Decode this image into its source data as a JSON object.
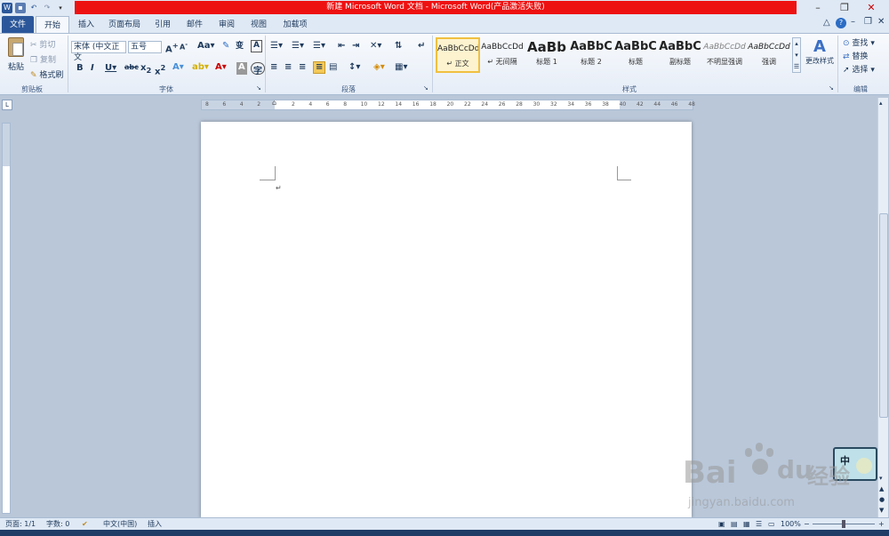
{
  "window": {
    "title": "新建 Microsoft Word 文档 - Microsoft Word(产品激活失败)"
  },
  "tabs": [
    "文件",
    "开始",
    "插入",
    "页面布局",
    "引用",
    "邮件",
    "审阅",
    "视图",
    "加载项"
  ],
  "clipboard": {
    "paste": "粘贴",
    "cut": "剪切",
    "copy": "复制",
    "format_painter": "格式刷",
    "label": "剪贴板"
  },
  "font": {
    "font_name": "宋体 (中文正文",
    "font_size": "五号",
    "label": "字体"
  },
  "paragraph": {
    "label": "段落"
  },
  "styles": {
    "items": [
      {
        "sample": "AaBbCcDd",
        "name": "↵ 正文"
      },
      {
        "sample": "AaBbCcDd",
        "name": "↵ 无间隔"
      },
      {
        "sample": "AaBb",
        "name": "标题 1"
      },
      {
        "sample": "AaBbC",
        "name": "标题 2"
      },
      {
        "sample": "AaBbC",
        "name": "标题"
      },
      {
        "sample": "AaBbC",
        "name": "副标题"
      },
      {
        "sample": "AaBbCcDd",
        "name": "不明显强调"
      },
      {
        "sample": "AaBbCcDd",
        "name": "强调"
      }
    ],
    "change_styles": "更改样式",
    "label": "样式"
  },
  "editing": {
    "find": "查找",
    "replace": "替换",
    "select": "选择",
    "label": "编辑"
  },
  "ruler": {
    "ticks": [
      "8",
      "6",
      "4",
      "2",
      "",
      "2",
      "4",
      "6",
      "8",
      "10",
      "12",
      "14",
      "16",
      "18",
      "20",
      "22",
      "24",
      "26",
      "28",
      "30",
      "32",
      "34",
      "36",
      "38",
      "40",
      "42",
      "44",
      "46",
      "48"
    ]
  },
  "statusbar": {
    "page": "页面: 1/1",
    "words": "字数: 0",
    "language": "中文(中国)",
    "mode": "插入",
    "zoom": "100%"
  },
  "ime": {
    "label": "中"
  },
  "watermark": {
    "brand": "Bai",
    "brand2": "du",
    "cn": "经验",
    "url": "jingyan.baidu.com"
  },
  "colors": {
    "title_red": "#ee1111",
    "file_tab": "#2b579a"
  }
}
